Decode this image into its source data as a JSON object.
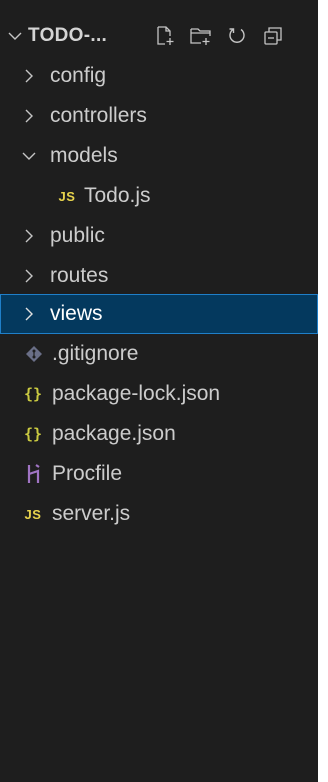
{
  "explorer": {
    "title": "TODO-...",
    "header_actions": [
      "new-file-icon",
      "new-folder-icon",
      "refresh-icon",
      "collapse-all-icon"
    ]
  },
  "tree": [
    {
      "label": "config",
      "type": "folder",
      "expanded": false
    },
    {
      "label": "controllers",
      "type": "folder",
      "expanded": false
    },
    {
      "label": "models",
      "type": "folder",
      "expanded": true
    },
    {
      "label": "Todo.js",
      "type": "js",
      "icon_text": "JS"
    },
    {
      "label": "public",
      "type": "folder",
      "expanded": false
    },
    {
      "label": "routes",
      "type": "folder",
      "expanded": false
    },
    {
      "label": "views",
      "type": "folder",
      "expanded": false,
      "selected": true
    },
    {
      "label": ".gitignore",
      "type": "git"
    },
    {
      "label": "package-lock.json",
      "type": "json",
      "icon_text": "{}"
    },
    {
      "label": "package.json",
      "type": "json",
      "icon_text": "{}"
    },
    {
      "label": "Procfile",
      "type": "heroku"
    },
    {
      "label": "server.js",
      "type": "js",
      "icon_text": "JS"
    }
  ],
  "colors": {
    "background": "#1e1e1e",
    "selection": "#04395e",
    "selection_border": "#1f7fc9",
    "js_icon": "#e8d44d",
    "json_icon": "#cbcb41",
    "heroku_icon": "#a074c4",
    "git_icon": "#6a6f87"
  }
}
